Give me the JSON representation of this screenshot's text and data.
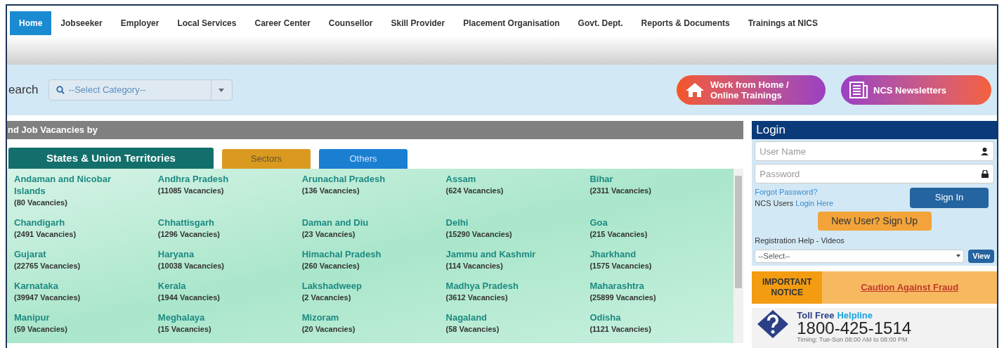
{
  "nav": {
    "items": [
      {
        "label": "Home",
        "selected": true
      },
      {
        "label": "Jobseeker",
        "selected": false
      },
      {
        "label": "Employer",
        "selected": false
      },
      {
        "label": "Local Services",
        "selected": false
      },
      {
        "label": "Career Center",
        "selected": false
      },
      {
        "label": "Counsellor",
        "selected": false
      },
      {
        "label": "Skill Provider",
        "selected": false
      },
      {
        "label": "Placement Organisation",
        "selected": false
      },
      {
        "label": "Govt. Dept.",
        "selected": false
      },
      {
        "label": "Reports & Documents",
        "selected": false
      },
      {
        "label": "Trainings at NICS",
        "selected": false
      }
    ]
  },
  "search": {
    "label": "earch",
    "placeholder": "--Select Category--"
  },
  "promo_buttons": [
    {
      "label": "Work from Home / Online Trainings",
      "kind": "home"
    },
    {
      "label": "NCS Newsletters",
      "kind": "news"
    }
  ],
  "vacancies": {
    "title": "nd Job Vacancies by",
    "tabs": [
      {
        "label": "States & Union Territories",
        "selected": true,
        "color": "#136f6b"
      },
      {
        "label": "Sectors",
        "selected": false,
        "color": "#d99a1f"
      },
      {
        "label": "Others",
        "selected": false,
        "color": "#1a7fd1"
      }
    ],
    "states": [
      {
        "name": "Andaman and Nicobar Islands",
        "count": "(80 Vacancies)"
      },
      {
        "name": "Andhra Pradesh",
        "count": "(11085 Vacancies)"
      },
      {
        "name": "Arunachal Pradesh",
        "count": "(136 Vacancies)"
      },
      {
        "name": "Assam",
        "count": "(624 Vacancies)"
      },
      {
        "name": "Bihar",
        "count": "(2311 Vacancies)"
      },
      {
        "name": "Chandigarh",
        "count": "(2491 Vacancies)"
      },
      {
        "name": "Chhattisgarh",
        "count": "(1296 Vacancies)"
      },
      {
        "name": "Daman and Diu",
        "count": "(23 Vacancies)"
      },
      {
        "name": "Delhi",
        "count": "(15290 Vacancies)"
      },
      {
        "name": "Goa",
        "count": "(215 Vacancies)"
      },
      {
        "name": "Gujarat",
        "count": "(22765 Vacancies)"
      },
      {
        "name": "Haryana",
        "count": "(10038 Vacancies)"
      },
      {
        "name": "Himachal Pradesh",
        "count": "(260 Vacancies)"
      },
      {
        "name": "Jammu and Kashmir",
        "count": "(114 Vacancies)"
      },
      {
        "name": "Jharkhand",
        "count": "(1575 Vacancies)"
      },
      {
        "name": "Karnataka",
        "count": "(39947 Vacancies)"
      },
      {
        "name": "Kerala",
        "count": "(1944 Vacancies)"
      },
      {
        "name": "Lakshadweep",
        "count": "(2 Vacancies)"
      },
      {
        "name": "Madhya Pradesh",
        "count": "(3612 Vacancies)"
      },
      {
        "name": "Maharashtra",
        "count": "(25899 Vacancies)"
      },
      {
        "name": "Manipur",
        "count": "(59 Vacancies)"
      },
      {
        "name": "Meghalaya",
        "count": "(15 Vacancies)"
      },
      {
        "name": "Mizoram",
        "count": "(20 Vacancies)"
      },
      {
        "name": "Nagaland",
        "count": "(58 Vacancies)"
      },
      {
        "name": "Odisha",
        "count": "(1121 Vacancies)"
      }
    ]
  },
  "login": {
    "title": "Login",
    "username_placeholder": "User Name",
    "password_placeholder": "Password",
    "forgot": "Forgot Password?",
    "ncs_users": "NCS Users",
    "login_here": "Login Here",
    "sign_in": "Sign In",
    "sign_up": "New User? Sign Up",
    "help_label": "Registration Help - Videos",
    "help_select": "--Select--",
    "view": "View"
  },
  "notice": {
    "label": "IMPORTANT NOTICE",
    "link": "Caution Against Fraud"
  },
  "helpline": {
    "prefix": "Toll Free",
    "highlight": "Helpline",
    "number": "1800-425-1514",
    "timing": "Timing: Tue-Sun 08:00 AM to 08:00 PM"
  }
}
